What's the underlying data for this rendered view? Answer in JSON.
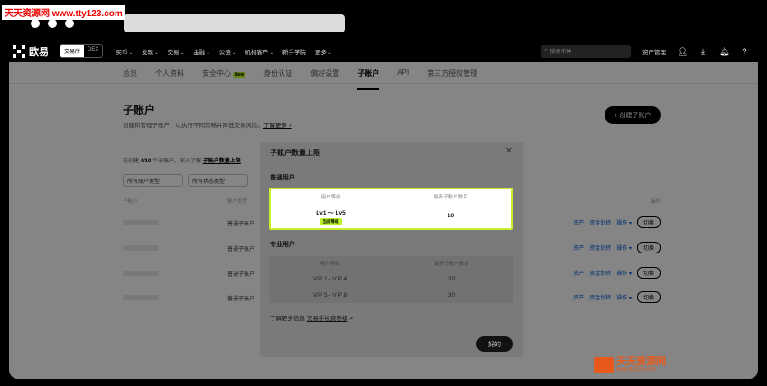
{
  "watermark_top": "天天资源网 www.tty123.com",
  "nav": {
    "logo": "欧易",
    "mode": [
      "交易所",
      "DEX"
    ],
    "menu": [
      "买币",
      "发现",
      "交易",
      "金融",
      "公链",
      "机构客户",
      "新手学院",
      "更多"
    ],
    "search_placeholder": "搜索币种",
    "assets": "资产管理"
  },
  "tabs": [
    {
      "label": "总览"
    },
    {
      "label": "个人资料"
    },
    {
      "label": "安全中心",
      "badge": "New"
    },
    {
      "label": "身份认证"
    },
    {
      "label": "偏好设置"
    },
    {
      "label": "子账户",
      "active": true
    },
    {
      "label": "API"
    },
    {
      "label": "第三方授权管理"
    }
  ],
  "page": {
    "title": "子账户",
    "desc": "创建和管理子账户，以执行不同策略并降低交易风险。",
    "learn_more": "了解更多 >",
    "create_btn": "+ 创建子账户",
    "created_prefix": "已创建 ",
    "created_count": "4/10",
    "created_mid": " 个子账户。深入了解 ",
    "created_link": "子账户数量上限",
    "filters": [
      "所有账户类型",
      "所有状态类型"
    ],
    "th": [
      "子账户",
      "账户类型",
      "操作"
    ],
    "rows": [
      {
        "type": "普通子账户"
      },
      {
        "type": "普通子账户"
      },
      {
        "type": "普通子账户"
      },
      {
        "type": "普通子账户"
      }
    ],
    "actions": [
      "资产",
      "资金划转",
      "操作 ▾",
      "切换"
    ]
  },
  "modal": {
    "title": "子账户数量上限",
    "close": "✕",
    "regular_section": "普通用户",
    "pro_section": "专业用户",
    "col_level": "用户等级",
    "col_max": "最多子账户数目",
    "regular_rows": [
      {
        "level": "Lv1 ～ Lv5",
        "badge": "当前等级",
        "max": "10"
      }
    ],
    "pro_rows": [
      {
        "level": "VIP 1 - VIP 4",
        "max": "20"
      },
      {
        "level": "VIP 5 - VIP 8",
        "max": "30"
      }
    ],
    "more_prefix": "了解更多信息 ",
    "more_link": "交易手续费等级",
    "more_suffix": " >",
    "ok": "好的"
  },
  "watermark_bottom": {
    "title": "天天资源网",
    "url": "www.tty123.com"
  }
}
